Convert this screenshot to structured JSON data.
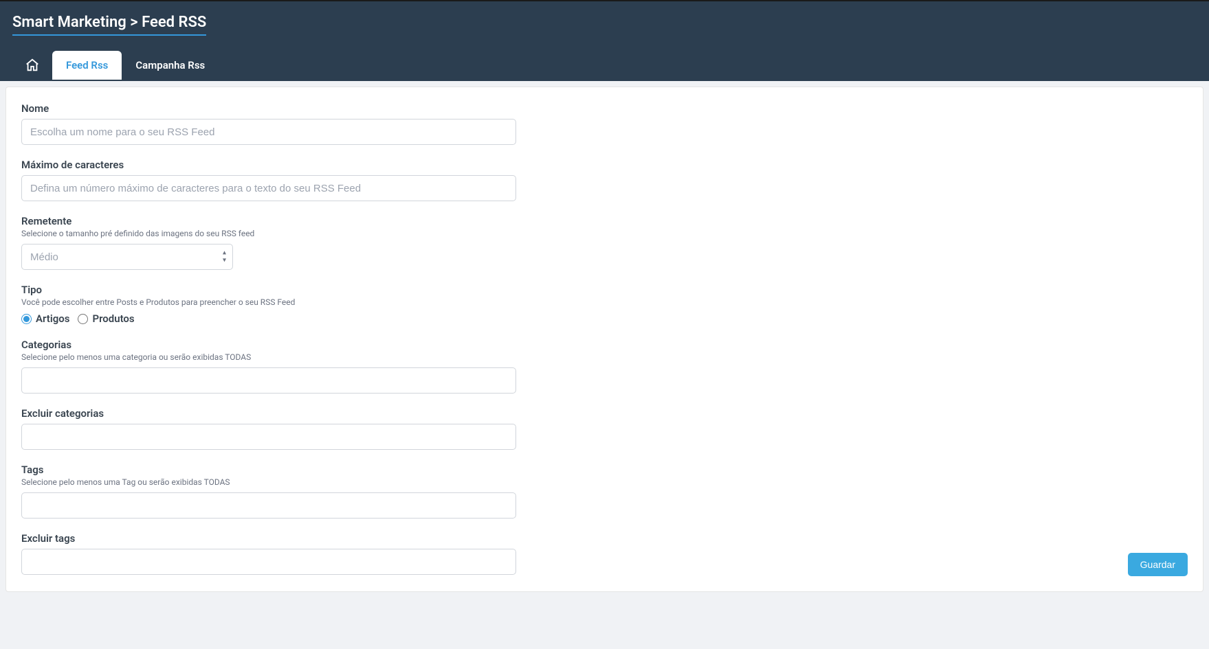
{
  "header": {
    "title": "Smart Marketing > Feed RSS"
  },
  "tabs": {
    "feed_rss": "Feed Rss",
    "campanha_rss": "Campanha Rss"
  },
  "form": {
    "nome": {
      "label": "Nome",
      "placeholder": "Escolha um nome para o seu RSS Feed"
    },
    "max_chars": {
      "label": "Máximo de caracteres",
      "placeholder": "Defina um número máximo de caracteres para o texto do seu RSS Feed"
    },
    "remetente": {
      "label": "Remetente",
      "hint": "Selecione o tamanho pré definido das imagens do seu RSS feed",
      "value": "Médio"
    },
    "tipo": {
      "label": "Tipo",
      "hint": "Você pode escolher entre Posts e Produtos para preencher o seu RSS Feed",
      "option_artigos": "Artigos",
      "option_produtos": "Produtos"
    },
    "categorias": {
      "label": "Categorias",
      "hint": "Selecione pelo menos uma categoria ou serão exibidas TODAS"
    },
    "excluir_categorias": {
      "label": "Excluir categorias"
    },
    "tags": {
      "label": "Tags",
      "hint": "Selecione pelo menos uma Tag ou serão exibidas TODAS"
    },
    "excluir_tags": {
      "label": "Excluir tags"
    }
  },
  "actions": {
    "save": "Guardar"
  }
}
